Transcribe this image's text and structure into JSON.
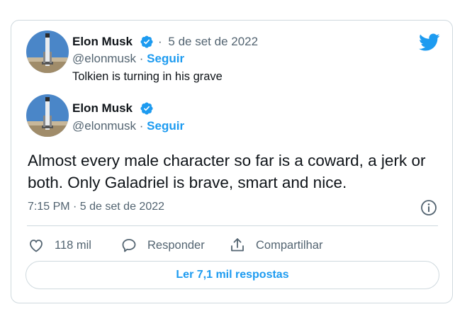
{
  "quoted_tweet": {
    "name": "Elon Musk",
    "separator": "·",
    "date": "5 de set de 2022",
    "handle": "@elonmusk",
    "follow_label": "Seguir",
    "text": "Tolkien is turning in his grave"
  },
  "main_tweet": {
    "name": "Elon Musk",
    "handle": "@elonmusk",
    "separator": "·",
    "follow_label": "Seguir",
    "text": "Almost every male character so far is a coward, a jerk or both. Only Galadriel is brave, smart and nice.",
    "timestamp": "7:15 PM · 5 de set de 2022"
  },
  "actions": {
    "like_count": "118 mil",
    "reply_label": "Responder",
    "share_label": "Compartilhar"
  },
  "read_replies_label": "Ler 7,1 mil respostas",
  "icons": {
    "brand": "twitter-bird-icon",
    "verified": "verified-badge-icon",
    "info": "info-icon",
    "like": "heart-icon",
    "reply": "reply-bubble-icon",
    "share": "share-icon"
  },
  "colors": {
    "accent": "#1d9bf0",
    "muted_text": "#536471",
    "border": "#cfd9de"
  }
}
